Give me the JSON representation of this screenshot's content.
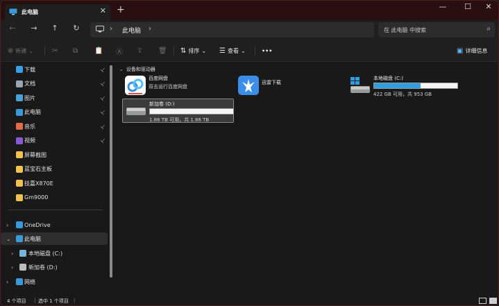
{
  "tab": {
    "title": "此电脑",
    "close": "✕",
    "new_tab": "+"
  },
  "window_controls": {
    "minimize": "—",
    "maximize": "☐",
    "close": "✕"
  },
  "nav": {
    "back": "←",
    "forward": "→",
    "up": "↑",
    "refresh": "↻"
  },
  "address": {
    "sep": "›",
    "crumb": "此电脑"
  },
  "search": {
    "placeholder": "在 此电脑 中搜索",
    "icon": "⌕"
  },
  "command_bar": {
    "new_label": "新建",
    "sort_label": "排序",
    "view_label": "查看",
    "more": "•••",
    "details_label": "详细信息"
  },
  "sidebar": {
    "pinned": [
      {
        "label": "下载",
        "icon": "download-icon",
        "color": "#3aa0e8"
      },
      {
        "label": "文档",
        "icon": "document-icon",
        "color": "#9aa6b8"
      },
      {
        "label": "图片",
        "icon": "pictures-icon",
        "color": "#4aa3d8"
      },
      {
        "label": "此电脑",
        "icon": "computer-icon",
        "color": "#3a9ad9"
      },
      {
        "label": "音乐",
        "icon": "music-icon",
        "color": "#e06a4a"
      },
      {
        "label": "视频",
        "icon": "video-icon",
        "color": "#8a5ad6"
      },
      {
        "label": "屏幕截图",
        "icon": "folder-icon",
        "color": "#f2c14e"
      },
      {
        "label": "蓝宝石主板",
        "icon": "folder-icon",
        "color": "#f2c14e"
      },
      {
        "label": "技嘉X870E",
        "icon": "folder-icon",
        "color": "#f2c14e"
      },
      {
        "label": "Gm9000",
        "icon": "folder-icon",
        "color": "#f2c14e"
      }
    ],
    "pin_glyph": "📌",
    "tree": [
      {
        "label": "OneDrive",
        "icon": "onedrive-icon",
        "color": "#3a9ad9"
      },
      {
        "label": "此电脑",
        "icon": "computer-icon",
        "color": "#3a9ad9"
      },
      {
        "label": "本地磁盘 (C:)",
        "icon": "drive-icon",
        "color": "#7ab4d8"
      },
      {
        "label": "新加卷 (D:)",
        "icon": "drive-icon",
        "color": "#bcbcbc"
      },
      {
        "label": "网络",
        "icon": "network-icon",
        "color": "#3a9ad9"
      }
    ]
  },
  "main": {
    "group_header": "设备和驱动器",
    "apps": [
      {
        "name": "百度网盘",
        "desc": "双击运行百度网盘"
      },
      {
        "name": "迅雷下载",
        "desc": ""
      }
    ],
    "drives": [
      {
        "name": "本地磁盘 (C:)",
        "capacity": "422 GB 可用，共 953 GB",
        "used_fraction": 0.56,
        "bar_color": "#2f9ee0"
      },
      {
        "name": "新加卷 (D:)",
        "capacity": "1.86 TB 可用，共 1.86 TB",
        "used_fraction": 0.0,
        "bar_color": "#2f9ee0"
      }
    ]
  },
  "status": {
    "count": "4 个项目",
    "selected": "选中 1 个项目"
  }
}
